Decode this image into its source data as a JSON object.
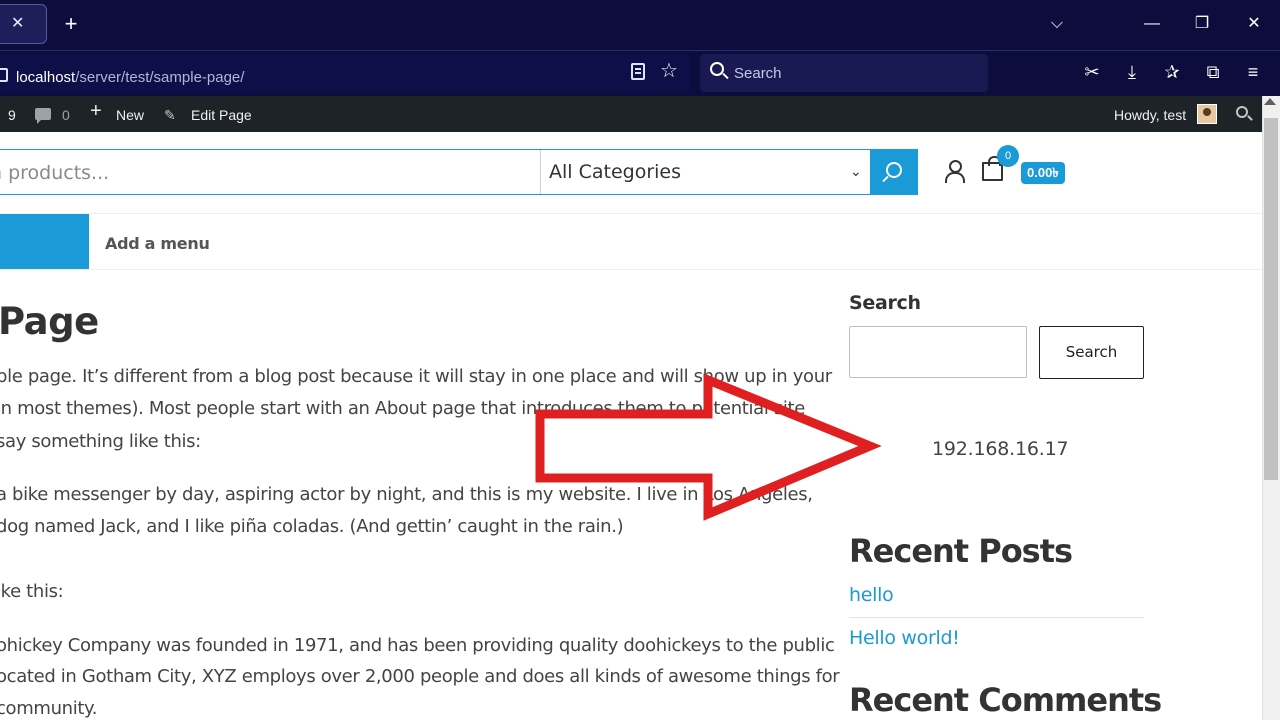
{
  "browser": {
    "tab_close_glyph": "✕",
    "new_tab_glyph": "+",
    "window_controls": {
      "list_tabs": "⌵",
      "minimize": "—",
      "restore": "❐",
      "close": "✕"
    },
    "url_host": "localhost",
    "url_path": "/server/test/sample-page/",
    "search_placeholder": "Search",
    "toolbar_icons": [
      "screenshot-icon",
      "download-icon",
      "extensions-icon",
      "puzzle-icon",
      "menu-icon"
    ]
  },
  "admin_bar": {
    "updates_count": "9",
    "comments_count": "0",
    "new_label": "New",
    "edit_label": "Edit Page",
    "howdy": "Howdy, test"
  },
  "site_header": {
    "search_placeholder": "h products...",
    "category_selected": "All Categories",
    "cart_count": "0",
    "cart_total": "0.00৳"
  },
  "nav": {
    "add_menu": "Add a menu"
  },
  "content": {
    "title": "Page",
    "lines": [
      "ple page. It’s different from a blog post because it will stay in one place and will show up in your",
      "in most themes). Most people start with an About page that introduces them to potential site",
      " say something like this:",
      "a bike messenger by day, aspiring actor by night, and this is my website. I live in Los Angeles,",
      "dog named Jack, and I like piña coladas. (And gettin’ caught in the rain.)",
      "ike this:",
      "ohickey Company was founded in 1971, and has been providing quality doohickeys to the public",
      "ocated in Gotham City, XYZ employs over 2,000 people and does all kinds of awesome things for",
      "community."
    ]
  },
  "sidebar": {
    "search_label": "Search",
    "search_button": "Search",
    "ip_address": "192.168.16.17",
    "recent_posts_heading": "Recent Posts",
    "recent_posts": [
      "hello",
      "Hello world!"
    ],
    "recent_comments_heading": "Recent Comments"
  },
  "colors": {
    "accent": "#1a9ad6",
    "arrow": "#e02020",
    "browser_chrome": "#0c0c3d",
    "admin_bar": "#1d2327"
  }
}
